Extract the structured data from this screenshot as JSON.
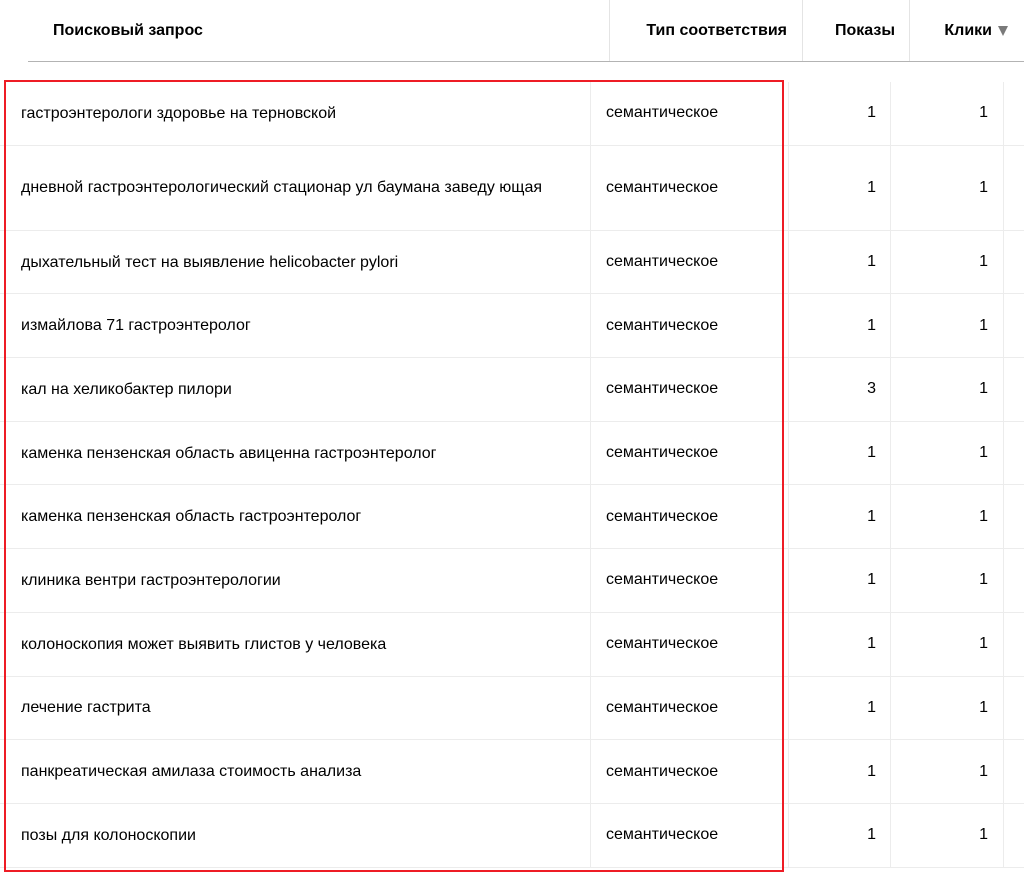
{
  "header": {
    "query_label": "Поисковый запрос",
    "match_label": "Тип соответствия",
    "shows_label": "Показы",
    "clicks_label": "Клики",
    "sort_icon": "triangle-down"
  },
  "highlight_color": "#ee1c25",
  "rows": [
    {
      "query": "гастроэнтерологи здоровье на терновской",
      "match": "семантическое",
      "shows": "1",
      "clicks": "1"
    },
    {
      "query": "дневной гастроэнтерологический стационар ул баумана заведу ющая",
      "match": "семантическое",
      "shows": "1",
      "clicks": "1"
    },
    {
      "query": "дыхательный тест на выявление helicobacter pylori",
      "match": "семантическое",
      "shows": "1",
      "clicks": "1"
    },
    {
      "query": "измайлова 71 гастроэнтеролог",
      "match": "семантическое",
      "shows": "1",
      "clicks": "1"
    },
    {
      "query": "кал на хеликобактер пилори",
      "match": "семантическое",
      "shows": "3",
      "clicks": "1"
    },
    {
      "query": "каменка пензенская область авиценна гастроэнтеролог",
      "match": "семантическое",
      "shows": "1",
      "clicks": "1"
    },
    {
      "query": "каменка пензенская область гастроэнтеролог",
      "match": "семантическое",
      "shows": "1",
      "clicks": "1"
    },
    {
      "query": "клиника вентри гастроэнтерологии",
      "match": "семантическое",
      "shows": "1",
      "clicks": "1"
    },
    {
      "query": "колоноскопия может выявить глистов у человека",
      "match": "семантическое",
      "shows": "1",
      "clicks": "1"
    },
    {
      "query": "лечение гастрита",
      "match": "семантическое",
      "shows": "1",
      "clicks": "1"
    },
    {
      "query": "панкреатическая амилаза стоимость анализа",
      "match": "семантическое",
      "shows": "1",
      "clicks": "1"
    },
    {
      "query": "позы для колоноскопии",
      "match": "семантическое",
      "shows": "1",
      "clicks": "1"
    }
  ]
}
